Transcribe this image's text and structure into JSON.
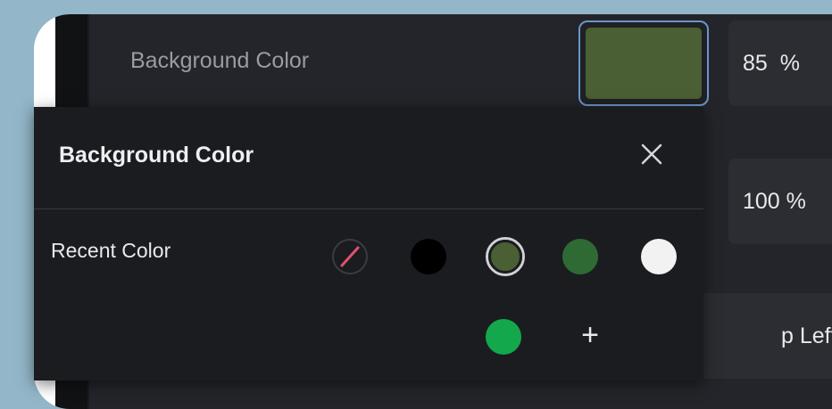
{
  "background_row": {
    "label": "Background Color",
    "swatch_color": "#4a5f33",
    "opacity": "85",
    "opacity_unit": "%"
  },
  "second_row": {
    "value": "100 %"
  },
  "alignment": {
    "visible_text": "p Left"
  },
  "popup": {
    "title": "Background Color",
    "close_icon": "close-icon",
    "recent_label": "Recent Color",
    "colors": [
      {
        "name": "none",
        "color": "transparent",
        "icon": "no-color-icon"
      },
      {
        "name": "black",
        "color": "#000000"
      },
      {
        "name": "olive",
        "color": "#4a5f33",
        "selected": true
      },
      {
        "name": "dark-green",
        "color": "#2f6a35"
      },
      {
        "name": "white",
        "color": "#f2f2f2"
      },
      {
        "name": "green",
        "color": "#12a84b"
      }
    ],
    "add_label": "+"
  }
}
